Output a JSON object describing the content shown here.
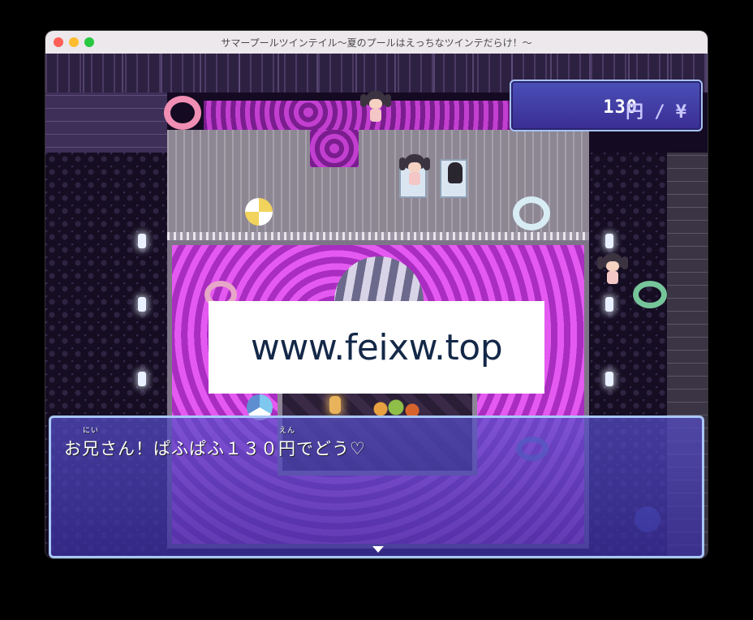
{
  "window": {
    "title": "サマープールツインテイル〜夏のプールはえっちなツインテだらけ！〜"
  },
  "hud": {
    "gold_amount": "130",
    "gold_unit": "円 / ¥"
  },
  "watermark": {
    "text": "www.feixw.top"
  },
  "message": {
    "part1": "お",
    "ruby_base1": "兄",
    "ruby_text1": "にい",
    "part2": "さん！ぱふぱふ１３０",
    "ruby_base2": "円",
    "ruby_text2": "えん",
    "part3": "でどう♡"
  },
  "colors": {
    "pool": "#e45af0",
    "window_fill": "#4a50b8",
    "window_border": "#a8c2f5"
  }
}
